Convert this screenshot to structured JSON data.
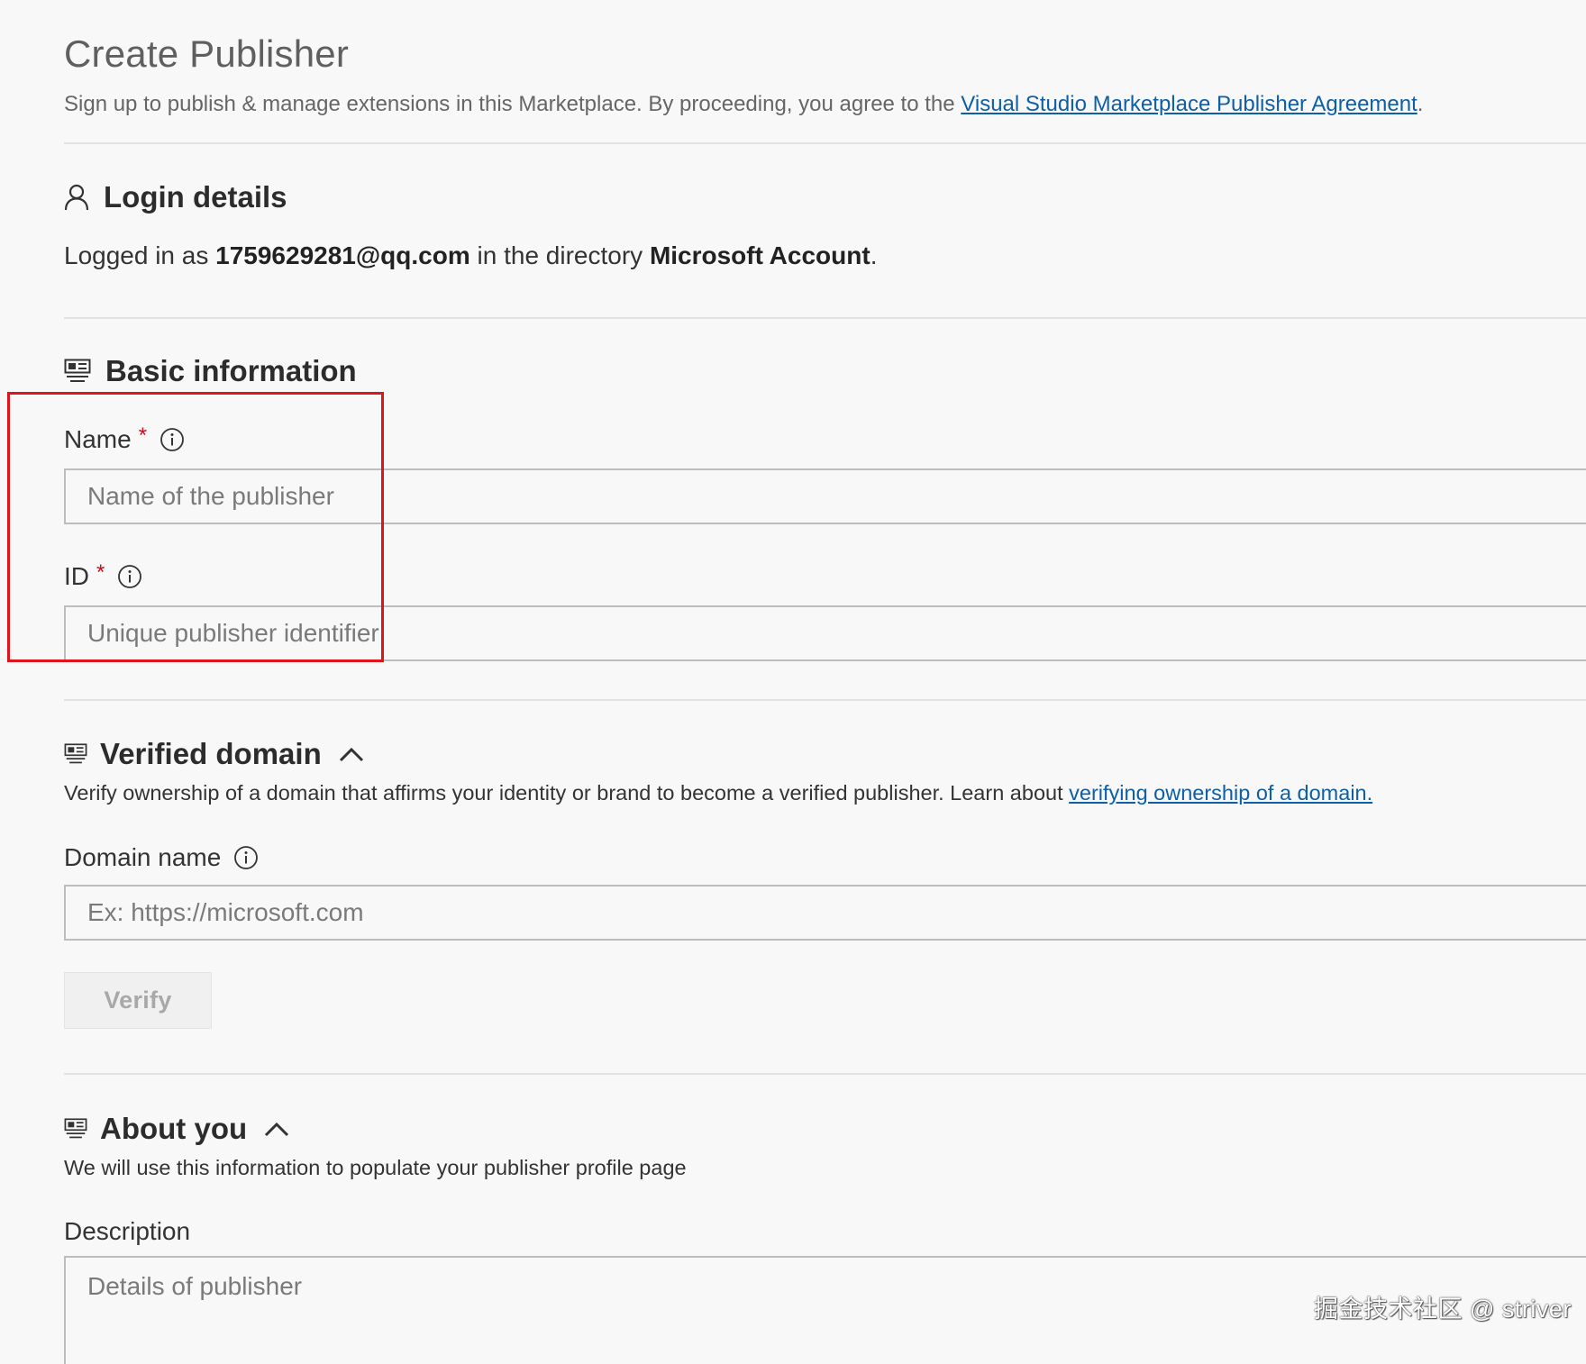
{
  "page": {
    "title": "Create Publisher",
    "intro_text": "Sign up to publish & manage extensions in this Marketplace. By proceeding, you agree to the ",
    "agreement_link": "Visual Studio Marketplace Publisher Agreement",
    "intro_end": "."
  },
  "login": {
    "title": "Login details",
    "icon": "person-icon",
    "prefix": "Logged in as ",
    "email": "1759629281@qq.com",
    "middle": " in the directory ",
    "directory": "Microsoft Account",
    "suffix": "."
  },
  "basic": {
    "title": "Basic information",
    "icon": "form-icon",
    "name_label": "Name",
    "name_required": "*",
    "name_placeholder": "Name of the publisher",
    "id_label": "ID",
    "id_required": "*",
    "id_placeholder": "Unique publisher identifier"
  },
  "verified_domain": {
    "title": "Verified domain",
    "icon": "form-icon",
    "description": "Verify ownership of a domain that affirms your identity or brand to become a verified publisher. Learn about ",
    "link": "verifying ownership of a domain.",
    "domain_label": "Domain name",
    "domain_placeholder": "Ex: https://microsoft.com",
    "verify_button": "Verify"
  },
  "about": {
    "title": "About you",
    "icon": "form-icon",
    "description": "We will use this information to populate your publisher profile page",
    "description_label": "Description",
    "description_placeholder": "Details of publisher"
  },
  "watermark": "掘金技术社区 @ striver",
  "colors": {
    "link": "#0d5fa8",
    "required": "#c50f1f",
    "highlight": "#e0151c",
    "background": "#f8f8f8"
  }
}
